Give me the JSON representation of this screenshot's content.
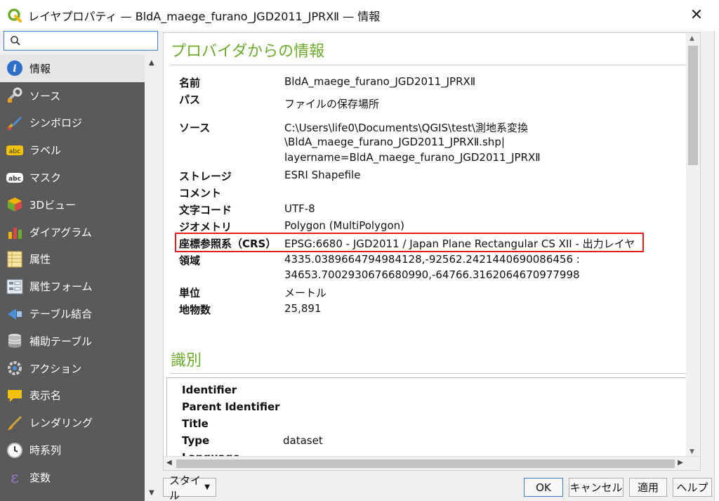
{
  "window": {
    "title": "レイヤプロパティ — BldA_maege_furano_JGD2011_JPRXⅡ — 情報",
    "close_label": "✕"
  },
  "sidebar": {
    "search": {
      "value": "",
      "placeholder": ""
    },
    "items": [
      {
        "label": "情報",
        "icon": "info-icon"
      },
      {
        "label": "ソース",
        "icon": "source-icon"
      },
      {
        "label": "シンボロジ",
        "icon": "symbology-icon"
      },
      {
        "label": "ラベル",
        "icon": "labels-icon"
      },
      {
        "label": "マスク",
        "icon": "mask-icon"
      },
      {
        "label": "3Dビュー",
        "icon": "3d-view-icon"
      },
      {
        "label": "ダイアグラム",
        "icon": "diagram-icon"
      },
      {
        "label": "属性",
        "icon": "fields-icon"
      },
      {
        "label": "属性フォーム",
        "icon": "attributes-form-icon"
      },
      {
        "label": "テーブル結合",
        "icon": "joins-icon"
      },
      {
        "label": "補助テーブル",
        "icon": "auxiliary-storage-icon"
      },
      {
        "label": "アクション",
        "icon": "actions-icon"
      },
      {
        "label": "表示名",
        "icon": "display-icon"
      },
      {
        "label": "レンダリング",
        "icon": "rendering-icon"
      },
      {
        "label": "時系列",
        "icon": "temporal-icon"
      },
      {
        "label": "変数",
        "icon": "variables-icon"
      }
    ]
  },
  "info": {
    "section_title": "プロバイダからの情報",
    "fields": {
      "name": {
        "label": "名前",
        "value": "BldA_maege_furano_JGD2011_JPRXⅡ"
      },
      "path": {
        "label": "パス",
        "value": "ファイルの保存場所"
      },
      "source": {
        "label": "ソース",
        "lines": [
          "C:\\Users\\life0\\Documents\\QGIS\\test\\測地系変換",
          "\\BldA_maege_furano_JGD2011_JPRXⅡ.shp|",
          "layername=BldA_maege_furano_JGD2011_JPRXⅡ"
        ]
      },
      "storage": {
        "label": "ストレージ",
        "value": "ESRI Shapefile"
      },
      "comment": {
        "label": "コメント",
        "value": ""
      },
      "encoding": {
        "label": "文字コード",
        "value": "UTF-8"
      },
      "geometry": {
        "label": "ジオメトリ",
        "value": "Polygon (MultiPolygon)"
      },
      "crs": {
        "label": "座標参照系（CRS）",
        "value": "EPSG:6680 - JGD2011 / Japan Plane Rectangular CS XII - 出力レイヤ"
      },
      "extent": {
        "label": "領域",
        "lines": [
          "4335.0389664794984128,-92562.2421440690086456 :",
          "34653.7002930676680990,-64766.3162064670977998"
        ]
      },
      "unit": {
        "label": "単位",
        "value": "メートル"
      },
      "count": {
        "label": "地物数",
        "value": "25,891"
      }
    }
  },
  "identification": {
    "section_title": "識別",
    "fields": {
      "identifier": {
        "label": "Identifier",
        "value": ""
      },
      "parent_identifier": {
        "label": "Parent Identifier",
        "value": ""
      },
      "title": {
        "label": "Title",
        "value": ""
      },
      "type": {
        "label": "Type",
        "value": "dataset"
      },
      "language": {
        "label": "Language",
        "value": ""
      }
    }
  },
  "footer": {
    "style_label": "スタイル",
    "ok_label": "OK",
    "cancel_label": "キャンセル",
    "apply_label": "適用",
    "help_label": "ヘルプ"
  },
  "colors": {
    "accent_green": "#6cab2d",
    "highlight_red": "#e02020",
    "sidebar_bg": "#5a5a5a",
    "focus_blue": "#3c7fd8"
  }
}
